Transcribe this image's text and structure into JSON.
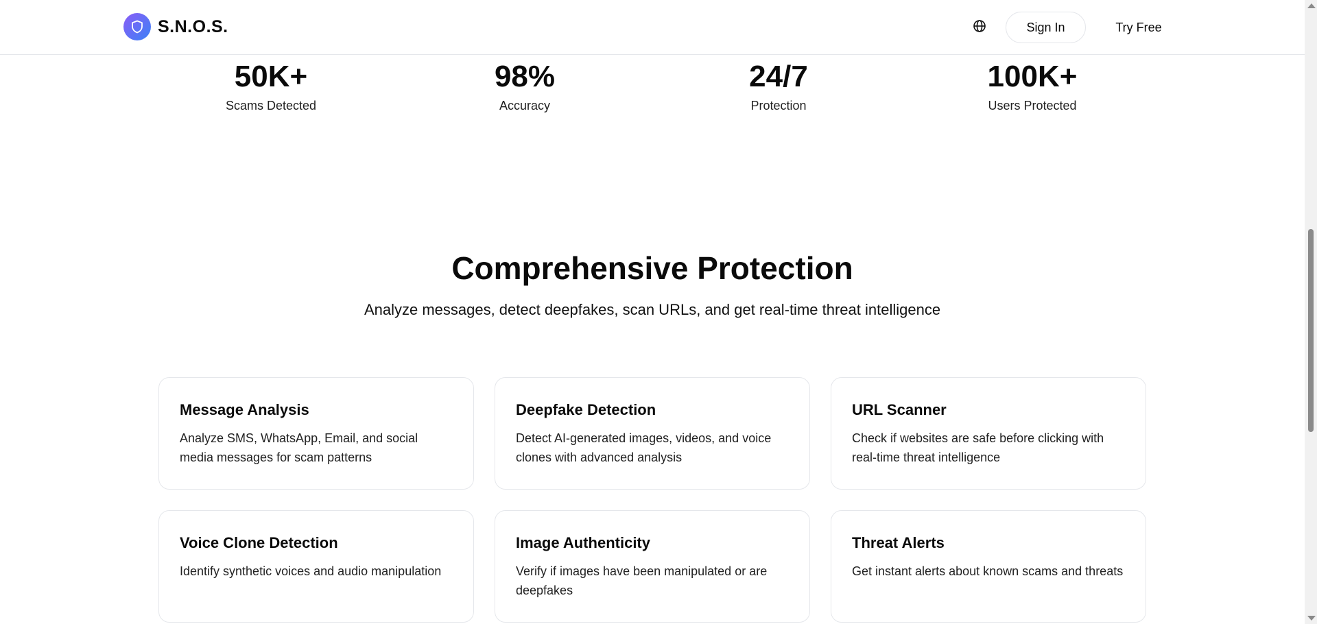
{
  "header": {
    "brand": "S.N.O.S.",
    "signin_label": "Sign In",
    "tryfree_label": "Try Free"
  },
  "stats": [
    {
      "value": "50K+",
      "label": "Scams Detected"
    },
    {
      "value": "98%",
      "label": "Accuracy"
    },
    {
      "value": "24/7",
      "label": "Protection"
    },
    {
      "value": "100K+",
      "label": "Users Protected"
    }
  ],
  "section": {
    "title": "Comprehensive Protection",
    "subtitle": "Analyze messages, detect deepfakes, scan URLs, and get real-time threat intelligence"
  },
  "features": [
    {
      "title": "Message Analysis",
      "description": "Analyze SMS, WhatsApp, Email, and social media messages for scam patterns"
    },
    {
      "title": "Deepfake Detection",
      "description": "Detect AI-generated images, videos, and voice clones with advanced analysis"
    },
    {
      "title": "URL Scanner",
      "description": "Check if websites are safe before clicking with real-time threat intelligence"
    },
    {
      "title": "Voice Clone Detection",
      "description": "Identify synthetic voices and audio manipulation"
    },
    {
      "title": "Image Authenticity",
      "description": "Verify if images have been manipulated or are deepfakes"
    },
    {
      "title": "Threat Alerts",
      "description": "Get instant alerts about known scams and threats"
    }
  ],
  "icons": {
    "logo": "shield-icon",
    "language": "globe-icon"
  },
  "colors": {
    "logo_gradient_start": "#8b5cf6",
    "logo_gradient_end": "#3b82f6",
    "border": "#e5e7eb"
  }
}
